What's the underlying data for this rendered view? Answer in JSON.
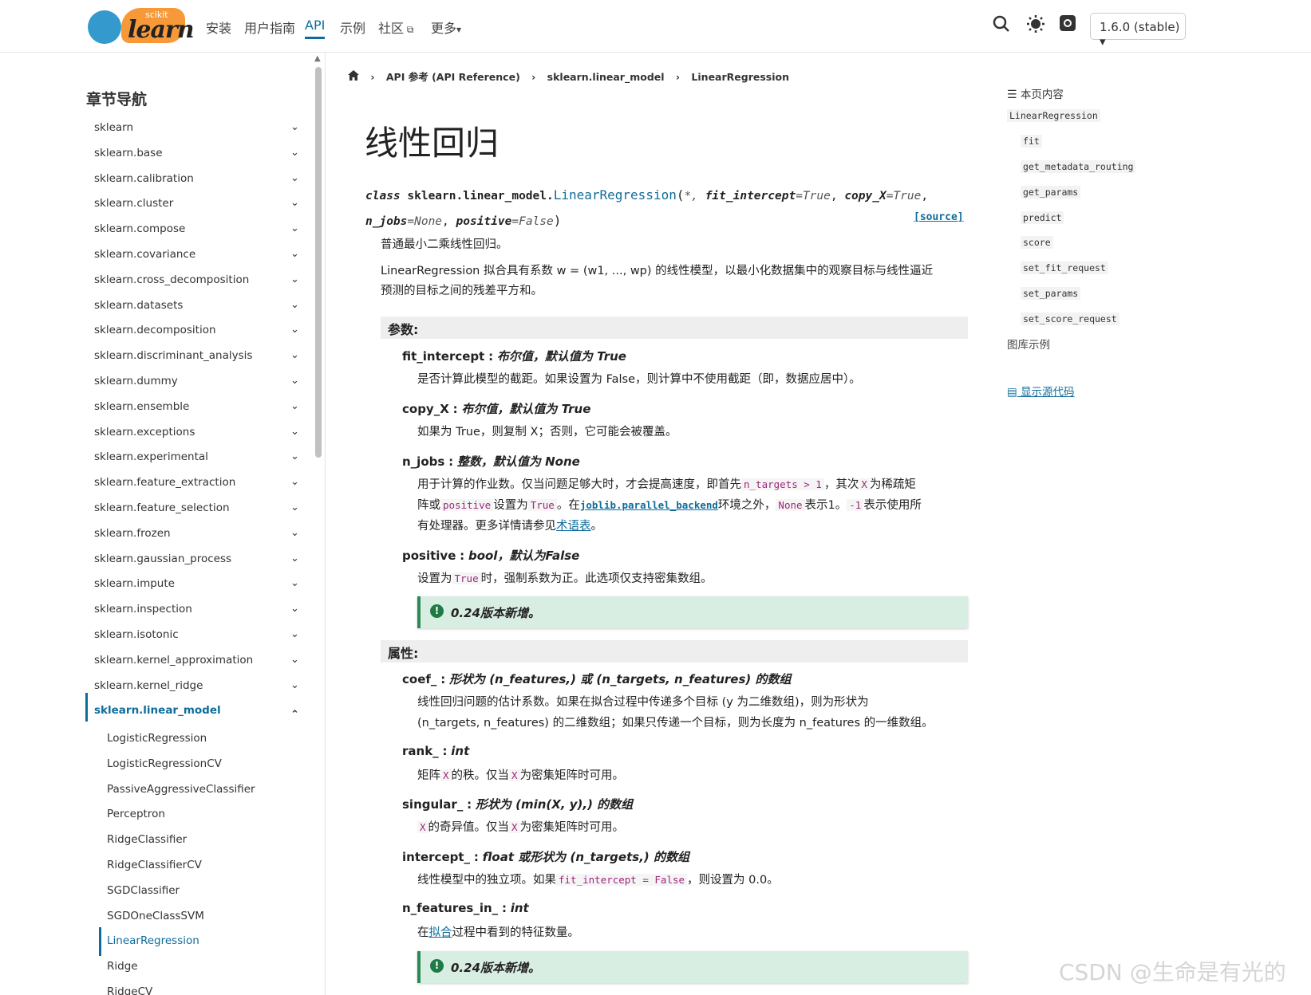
{
  "header": {
    "logo_small": "scikit",
    "logo_main": "learn",
    "nav": [
      "安装",
      "用户指南",
      "API",
      "示例",
      "社区",
      "更多"
    ],
    "community_icon": "external-link-icon",
    "more_caret": "▾",
    "version": "1.6.0 (stable) ▾"
  },
  "sidebar": {
    "title": "章节导航",
    "items": [
      "sklearn",
      "sklearn.base",
      "sklearn.calibration",
      "sklearn.cluster",
      "sklearn.compose",
      "sklearn.covariance",
      "sklearn.cross_decomposition",
      "sklearn.datasets",
      "sklearn.decomposition",
      "sklearn.discriminant_analysis",
      "sklearn.dummy",
      "sklearn.ensemble",
      "sklearn.exceptions",
      "sklearn.experimental",
      "sklearn.feature_extraction",
      "sklearn.feature_selection",
      "sklearn.frozen",
      "sklearn.gaussian_process",
      "sklearn.impute",
      "sklearn.inspection",
      "sklearn.isotonic",
      "sklearn.kernel_approximation",
      "sklearn.kernel_ridge",
      "sklearn.linear_model"
    ],
    "subitems": [
      "LogisticRegression",
      "LogisticRegressionCV",
      "PassiveAggressiveClassifier",
      "Perceptron",
      "RidgeClassifier",
      "RidgeClassifierCV",
      "SGDClassifier",
      "SGDOneClassSVM",
      "LinearRegression",
      "Ridge",
      "RidgeCV"
    ]
  },
  "breadcrumb": [
    "API 参考 (API Reference)",
    "sklearn.linear_model",
    "LinearRegression"
  ],
  "page": {
    "title": "线性回归",
    "sig_class": "class",
    "sig_module": "sklearn.linear_model.",
    "sig_name": "LinearRegression",
    "sig_open": "(",
    "sig_star": "*, ",
    "p1n": "fit_intercept",
    "p1v": "=True",
    "p2n": "copy_X",
    "p2v": "=True",
    "p3n": "n_jobs",
    "p3v": "=None",
    "p4n": "positive",
    "p4v": "=False",
    "sig_close": ")",
    "source": "[source]",
    "summary": "普通最小二乘线性回归。",
    "desc1": "LinearRegression 拟合具有系数 w = (w1, ..., wp) 的线性模型，以最小化数据集中的观察目标与线性逼近",
    "desc2": "预测的目标之间的残差平方和。",
    "params_title": "参数:",
    "attrs_title": "属性:"
  },
  "params": {
    "fit_intercept": {
      "name": "fit_intercept",
      "type": "布尔值，默认值为 True",
      "desc": "是否计算此模型的截距。如果设置为 False，则计算中不使用截距（即，数据应居中）。"
    },
    "copy_X": {
      "name": "copy_X",
      "type": "布尔值，默认值为 True",
      "desc": "如果为 True，则复制 X；否则，它可能会被覆盖。"
    },
    "n_jobs": {
      "name": "n_jobs",
      "type": "整数，默认值为 None",
      "l1a": "用于计算的作业数。仅当问题足够大时，才会提高速度，即首先",
      "l1code": "n_targets > 1",
      "l1b": "，其次",
      "l1code2": "X",
      "l1c": "为稀疏矩",
      "l2a": "阵或",
      "l2code": "positive",
      "l2b": "设置为",
      "l2code2": "True",
      "l2c": "。在",
      "l2link": "joblib.parallel_backend",
      "l2d": "环境之外，",
      "l2code3": "None",
      "l2e": "表示1。",
      "l2code4": "-1",
      "l2f": "表示使用所",
      "l3a": "有处理器。更多详情请参见",
      "l3link": "术语表",
      "l3b": "。"
    },
    "positive": {
      "name": "positive",
      "type": "bool，默认为False",
      "desc_a": "设置为",
      "desc_code": "True",
      "desc_b": "时，强制系数为正。此选项仅支持密集数组。"
    }
  },
  "note1": "0.24版本新增。",
  "attrs": {
    "coef": {
      "name": "coef_",
      "type": "形状为 (n_features,) 或 (n_targets, n_features) 的数组",
      "d1": "线性回归问题的估计系数。如果在拟合过程中传递多个目标 (y 为二维数组)，则为形状为",
      "d2": "(n_targets, n_features) 的二维数组；如果只传递一个目标，则为长度为 n_features 的一维数组。"
    },
    "rank": {
      "name": "rank_",
      "type": "int",
      "da": "矩阵",
      "dcode": "X",
      "db": "的秩。仅当",
      "dcode2": "X",
      "dc": "为密集矩阵时可用。"
    },
    "singular": {
      "name": "singular_",
      "type": "形状为 (min(X, y),) 的数组",
      "dcode": "X",
      "da": "的奇异值。仅当",
      "dcode2": "X",
      "db": "为密集矩阵时可用。"
    },
    "intercept": {
      "name": "intercept_",
      "type": "float 或形状为 (n_targets,) 的数组",
      "da": "线性模型中的独立项。如果",
      "dcode": "fit_intercept = False",
      "db": "，则设置为 0.0。"
    },
    "nfeat": {
      "name": "n_features_in_",
      "type": "int",
      "da": "在",
      "dlink": "拟合",
      "db": "过程中看到的特征数量。"
    }
  },
  "note2": "0.24版本新增。",
  "toc": {
    "title": "本页内容",
    "items": [
      "LinearRegression",
      "fit",
      "get_metadata_routing",
      "get_params",
      "predict",
      "score",
      "set_fit_request",
      "set_params",
      "set_score_request"
    ],
    "examples": "图库示例",
    "show_source": "显示源代码"
  },
  "watermark": "CSDN @生命是有光的"
}
